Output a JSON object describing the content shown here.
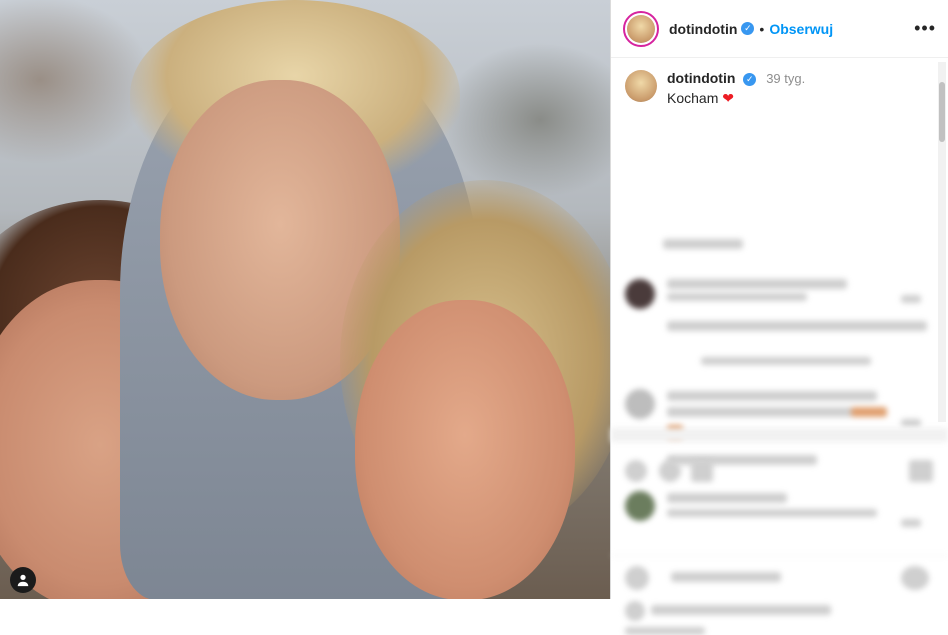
{
  "post": {
    "username": "dotindotin",
    "verified_icon": "verified-badge-icon",
    "separator": "•",
    "follow_label": "Obserwuj",
    "more_label": "•••",
    "caption": {
      "username": "dotindotin",
      "time": "39 tyg.",
      "text": "Kocham",
      "emoji": "❤"
    }
  },
  "colors": {
    "accent": "#0095f6",
    "verified": "#3897f0",
    "heart": "#ed1c24",
    "text": "#262626",
    "muted": "#8e8e8e"
  },
  "icons": [
    "user-icon",
    "more-icon",
    "verified-badge-icon",
    "heart-emoji"
  ]
}
